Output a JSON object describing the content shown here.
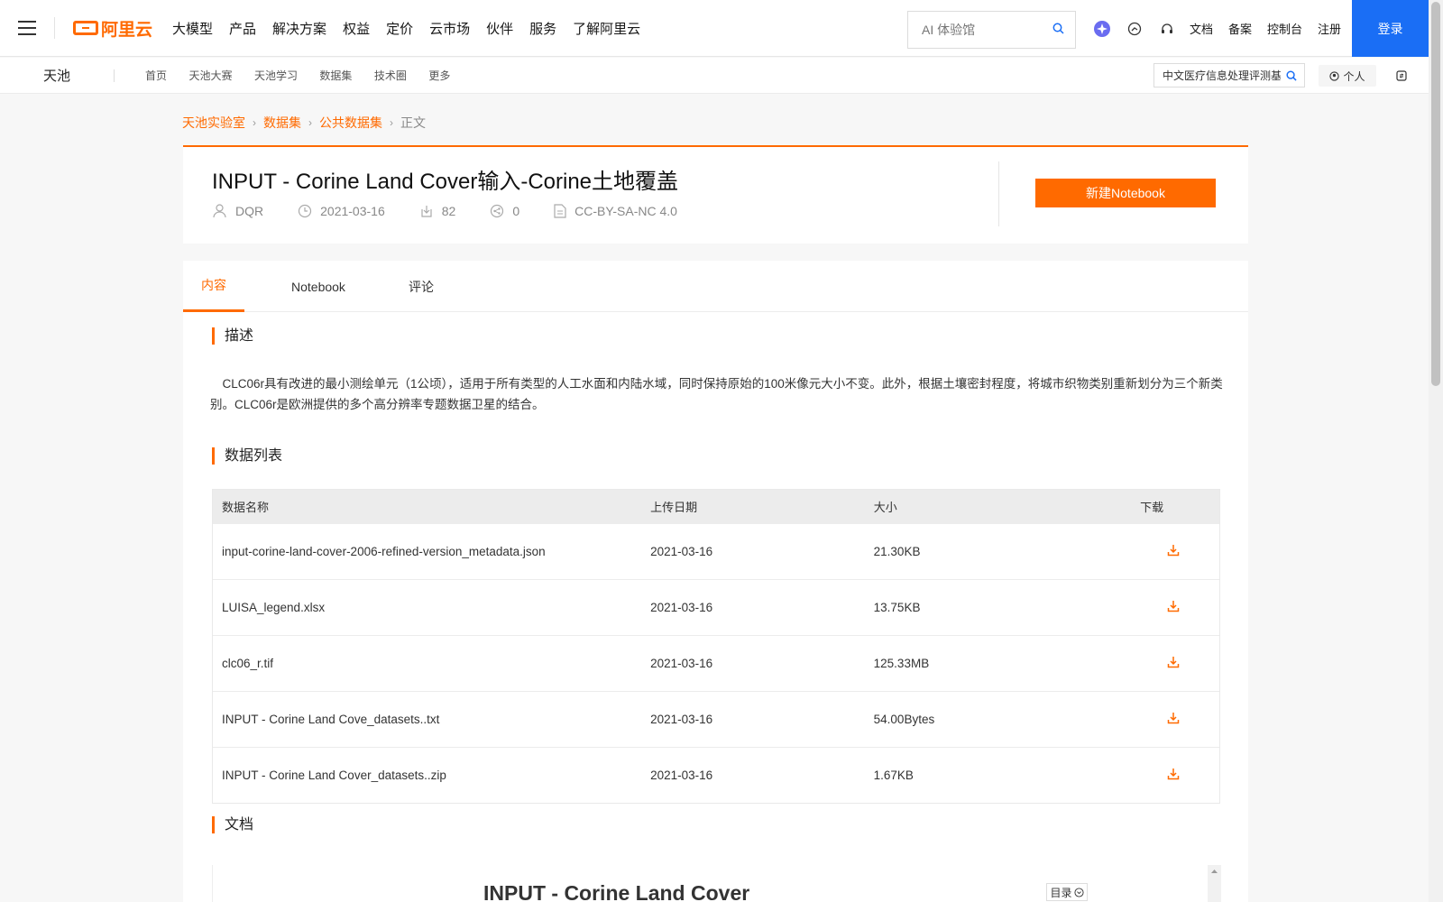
{
  "topbar": {
    "logo_text": "阿里云",
    "nav": [
      "大模型",
      "产品",
      "解决方案",
      "权益",
      "定价",
      "云市场",
      "伙伴",
      "服务",
      "了解阿里云"
    ],
    "search_placeholder": "AI 体验馆",
    "links": [
      "文档",
      "备案",
      "控制台",
      "注册"
    ],
    "login": "登录"
  },
  "subbar": {
    "brand": "天池",
    "nav": [
      "首页",
      "天池大赛",
      "天池学习",
      "数据集",
      "技术圈",
      "更多"
    ],
    "search_value": "中文医疗信息处理评测基",
    "personal": "个人"
  },
  "breadcrumb": [
    "天池实验室",
    "数据集",
    "公共数据集",
    "正文"
  ],
  "dataset": {
    "title": "INPUT - Corine Land Cover输入-Corine土地覆盖",
    "author": "DQR",
    "date": "2021-03-16",
    "downloads": "82",
    "shares": "0",
    "license": "CC-BY-SA-NC 4.0",
    "notebook_button": "新建Notebook"
  },
  "tabs": [
    "内容",
    "Notebook",
    "评论"
  ],
  "sections": {
    "description_title": "描述",
    "description": "CLC06r具有改进的最小测绘单元（1公顷），适用于所有类型的人工水面和内陆水域，同时保持原始的100米像元大小不变。此外，根据土壤密封程度，将城市织物类别重新划分为三个新类别。CLC06r是欧洲提供的多个高分辨率专题数据卫星的结合。",
    "datalist_title": "数据列表",
    "docs_title": "文档"
  },
  "table": {
    "headers": [
      "数据名称",
      "上传日期",
      "大小",
      "下载"
    ],
    "rows": [
      {
        "name": "input-corine-land-cover-2006-refined-version_metadata.json",
        "date": "2021-03-16",
        "size": "21.30KB"
      },
      {
        "name": "LUISA_legend.xlsx",
        "date": "2021-03-16",
        "size": "13.75KB"
      },
      {
        "name": "clc06_r.tif",
        "date": "2021-03-16",
        "size": "125.33MB"
      },
      {
        "name": "INPUT - Corine Land Cove_datasets..txt",
        "date": "2021-03-16",
        "size": "54.00Bytes"
      },
      {
        "name": "INPUT - Corine Land Cover_datasets..zip",
        "date": "2021-03-16",
        "size": "1.67KB"
      }
    ]
  },
  "doc": {
    "title": "INPUT - Corine Land Cover",
    "toc": "目录"
  },
  "colors": {
    "accent": "#ff6a00",
    "login": "#1a6ef5"
  }
}
